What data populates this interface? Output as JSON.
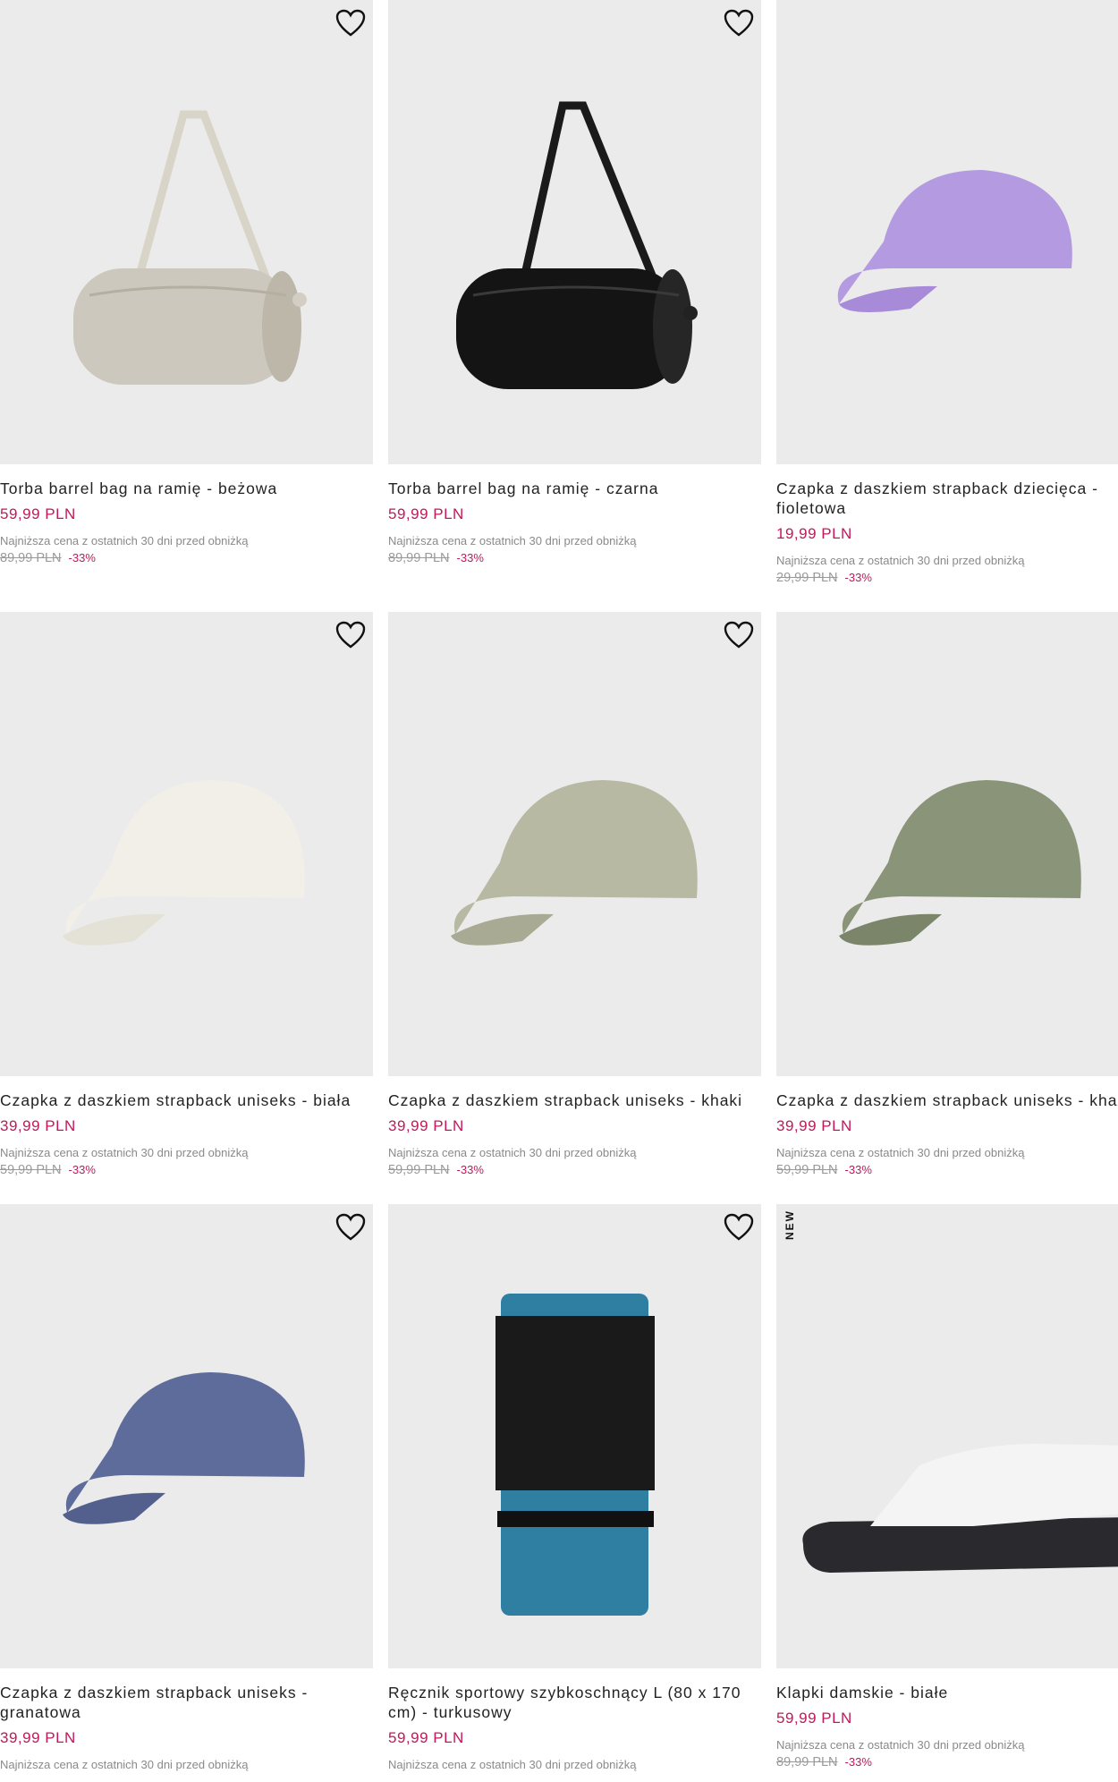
{
  "favorite_icon": "heart-outline-icon",
  "colors": {
    "price": "#c2185b",
    "image_bg": "#ebebeb"
  },
  "products": [
    {
      "title": "Torba barrel bag na ramię - beżowa",
      "price": "59,99 PLN",
      "lowest_label": "Najniższa cena z ostatnich 30 dni przed obniżką",
      "old_price": "89,99 PLN",
      "discount": "-33%"
    },
    {
      "title": "Torba barrel bag na ramię - czarna",
      "price": "59,99 PLN",
      "lowest_label": "Najniższa cena z ostatnich 30 dni przed obniżką",
      "old_price": "89,99 PLN",
      "discount": "-33%"
    },
    {
      "title": "Czapka z daszkiem strapback dziecięca - fioletowa",
      "price": "19,99 PLN",
      "lowest_label": "Najniższa cena z ostatnich 30 dni przed obniżką",
      "old_price": "29,99 PLN",
      "discount": "-33%"
    },
    {
      "title": "Czapka z daszkiem strapback uniseks - biała",
      "price": "39,99 PLN",
      "lowest_label": "Najniższa cena z ostatnich 30 dni przed obniżką",
      "old_price": "59,99 PLN",
      "discount": "-33%"
    },
    {
      "title": "Czapka z daszkiem strapback uniseks - khaki",
      "price": "39,99 PLN",
      "lowest_label": "Najniższa cena z ostatnich 30 dni przed obniżką",
      "old_price": "59,99 PLN",
      "discount": "-33%"
    },
    {
      "title": "Czapka z daszkiem strapback uniseks - kha",
      "price": "39,99 PLN",
      "lowest_label": "Najniższa cena z ostatnich 30 dni przed obniżką",
      "old_price": "59,99 PLN",
      "discount": "-33%"
    },
    {
      "title": "Czapka z daszkiem strapback uniseks - granatowa",
      "price": "39,99 PLN",
      "lowest_label": "Najniższa cena z ostatnich 30 dni przed obniżką"
    },
    {
      "title": "Ręcznik sportowy szybkoschnący L (80 x 170 cm) - turkusowy",
      "price": "59,99 PLN",
      "lowest_label": "Najniższa cena z ostatnich 30 dni przed obniżką"
    },
    {
      "title": "Klapki damskie - białe",
      "price": "59,99 PLN",
      "lowest_label": "Najniższa cena z ostatnich 30 dni przed obniżką",
      "old_price": "89,99 PLN",
      "discount": "-33%",
      "badge": "NEW"
    }
  ]
}
